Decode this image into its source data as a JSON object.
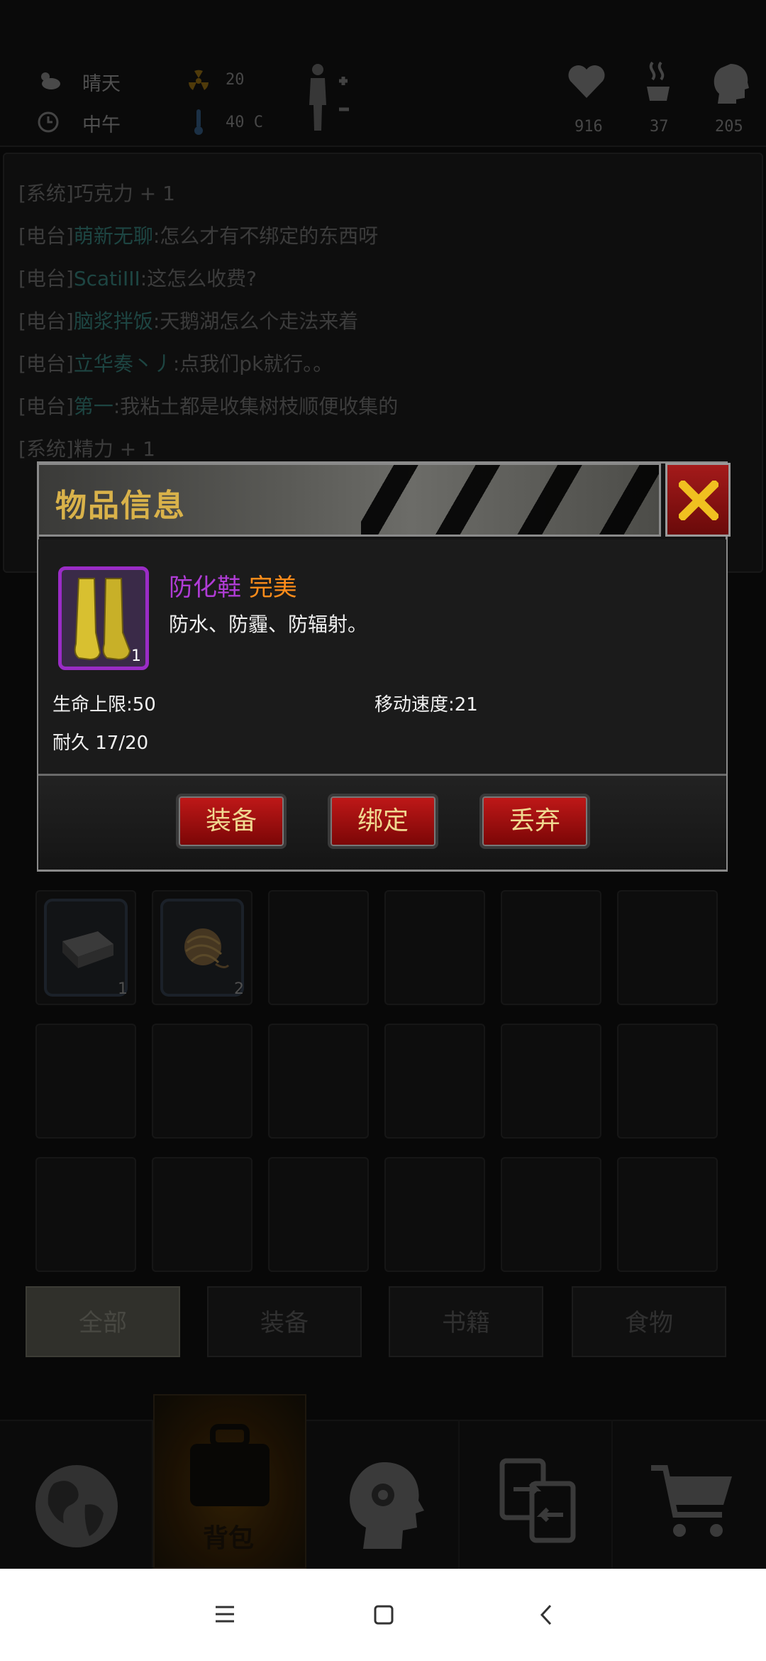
{
  "status": {
    "weather": "晴天",
    "time": "中午",
    "radiation": "20",
    "temperature": "40 C",
    "health": "916",
    "hunger": "37",
    "thirst": "205"
  },
  "chat": [
    {
      "tag": "[系统]",
      "user": "",
      "text": "巧克力 + 1"
    },
    {
      "tag": "[电台]",
      "user": "萌新无聊",
      "text": ":怎么才有不绑定的东西呀"
    },
    {
      "tag": "[电台]",
      "user": "ScatiIII",
      "text": ":这怎么收费?"
    },
    {
      "tag": "[电台]",
      "user": "脑浆拌饭",
      "text": ":天鹅湖怎么个走法来着"
    },
    {
      "tag": "[电台]",
      "user": "立华奏丶丿",
      "text": ":点我们pk就行。。"
    },
    {
      "tag": "[电台]",
      "user": "第一",
      "text": ":我粘土都是收集树枝顺便收集的"
    },
    {
      "tag": "[系统]",
      "user": "",
      "text": "精力 + 1"
    }
  ],
  "inventory": {
    "slots_row1": [
      {
        "icon": "brick-icon",
        "qty": "1"
      },
      {
        "icon": "yarn-ball-icon",
        "qty": "2"
      }
    ]
  },
  "categories": [
    "全部",
    "装备",
    "书籍",
    "食物"
  ],
  "nav": {
    "backpack_label": "背包"
  },
  "dialog": {
    "title": "物品信息",
    "item_name": "防化鞋",
    "item_quality": "完美",
    "item_desc": "防水、防霾、防辐射。",
    "item_qty": "1",
    "stat_hp": "生命上限:50",
    "stat_speed": "移动速度:21",
    "durability": "耐久 17/20",
    "buttons": {
      "equip": "装备",
      "bind": "绑定",
      "discard": "丢弃"
    }
  },
  "colors": {
    "title_gold": "#d9b24a",
    "quality_orange": "#ff8c1a",
    "item_purple": "#b03cd6",
    "button_red": "#c01818"
  }
}
